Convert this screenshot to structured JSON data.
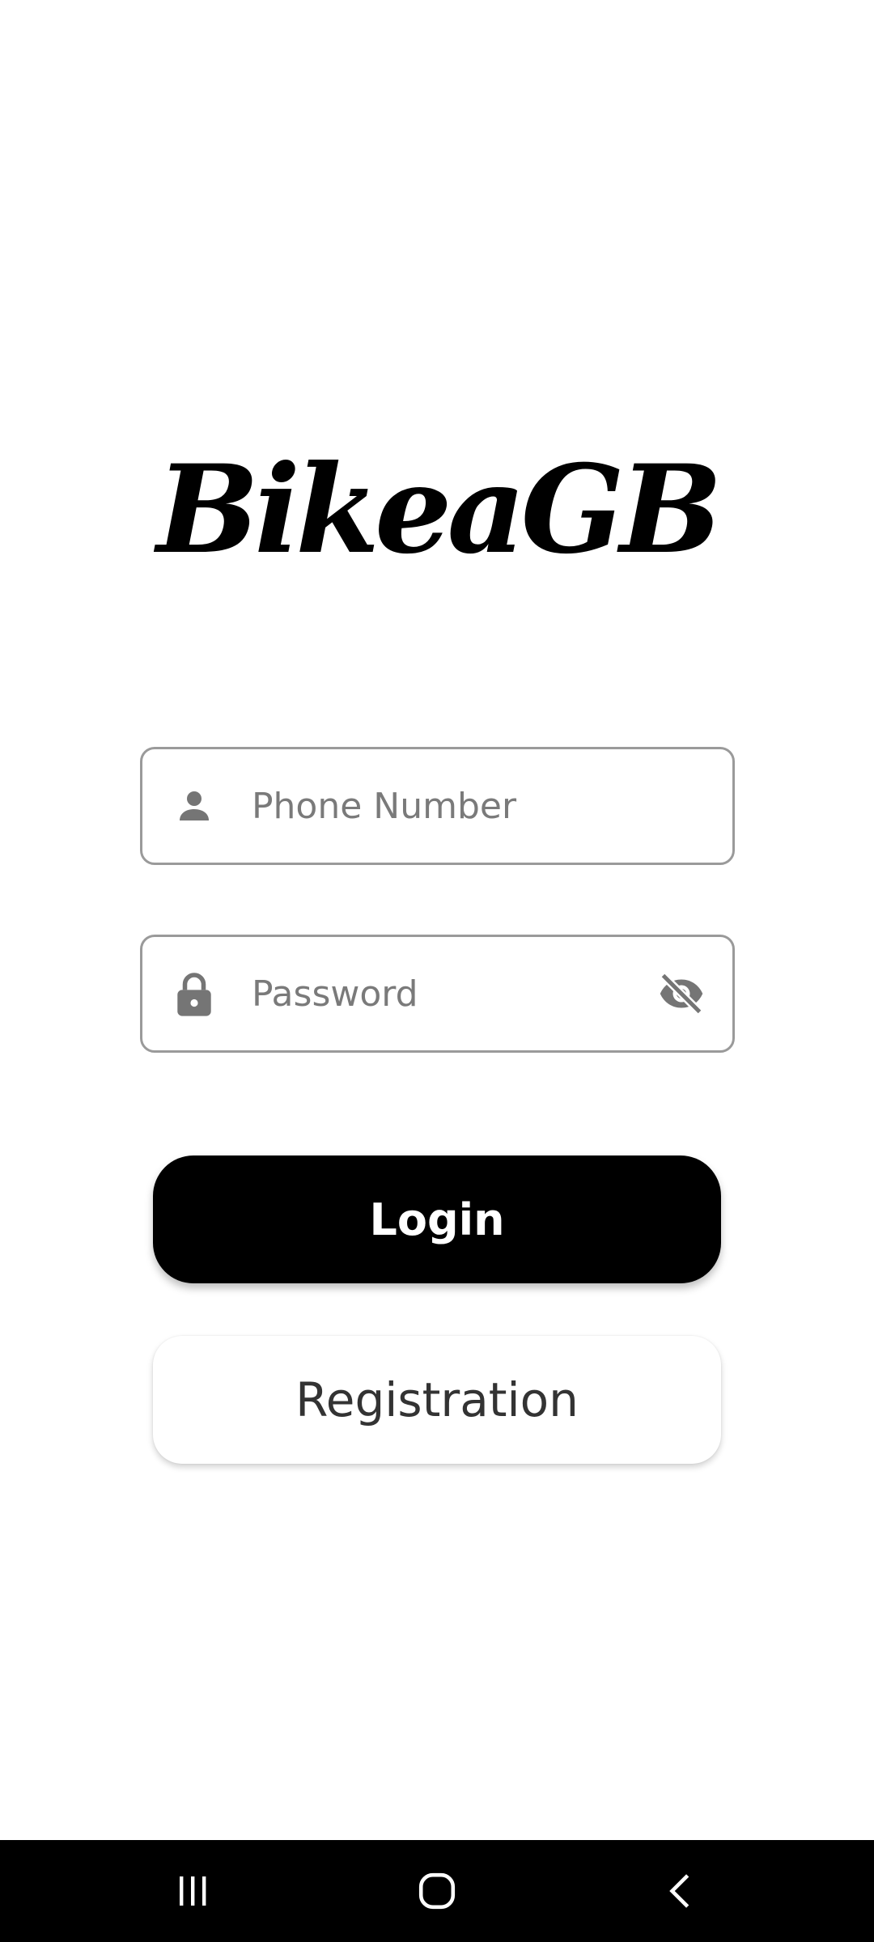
{
  "app": {
    "logo_text": "BikeaGB"
  },
  "form": {
    "phone_placeholder": "Phone Number",
    "phone_value": "",
    "password_placeholder": "Password",
    "password_value": "",
    "leading_icons": [
      "person-icon",
      "lock-icon"
    ],
    "password_toggle_icon": "eye-off-icon"
  },
  "buttons": {
    "login_label": "Login",
    "registration_label": "Registration"
  },
  "system_nav": {
    "items": [
      "recents-icon",
      "home-icon",
      "back-icon"
    ]
  },
  "colors": {
    "primary": "#000000",
    "background": "#ffffff",
    "field_border": "#9a9a9a",
    "icon": "#757575"
  }
}
